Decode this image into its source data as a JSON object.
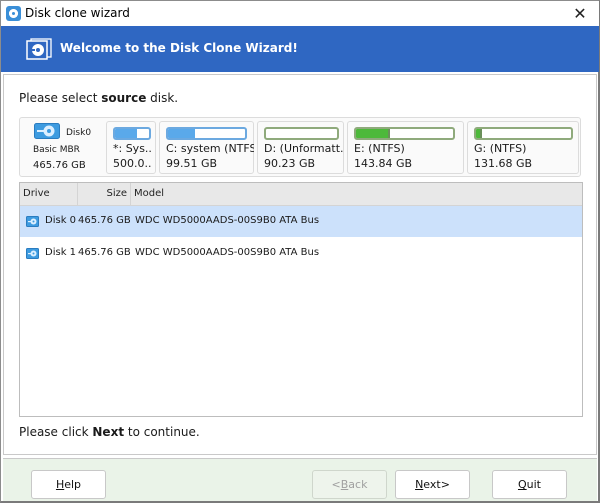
{
  "window": {
    "title": "Disk clone wizard",
    "close_glyph": "✕"
  },
  "banner": {
    "title": "Welcome to the Disk Clone Wizard!"
  },
  "prompt": {
    "prefix": "Please select ",
    "bold": "source",
    "suffix": " disk."
  },
  "disk_map": {
    "name": "Disk0",
    "type": "Basic MBR",
    "size": "465.76 GB",
    "partitions": [
      {
        "label": "*: Sys..",
        "size": "500.0..",
        "used_fraction": 0.65,
        "color": "blue"
      },
      {
        "label": "C: system (NTFS",
        "size": "99.51 GB",
        "used_fraction": 0.35,
        "color": "blue"
      },
      {
        "label": "D: (Unformatt..",
        "size": "90.23 GB",
        "used_fraction": 0.0,
        "color": "green"
      },
      {
        "label": "E: (NTFS)",
        "size": "143.84 GB",
        "used_fraction": 0.35,
        "color": "green"
      },
      {
        "label": "G: (NTFS)",
        "size": "131.68 GB",
        "used_fraction": 0.06,
        "color": "green"
      }
    ]
  },
  "table": {
    "columns": [
      "Drive",
      "Size",
      "Model"
    ],
    "rows": [
      {
        "drive": "Disk 0",
        "size": "465.76 GB",
        "model": "WDC WD5000AADS-00S9B0 ATA Bus",
        "selected": true
      },
      {
        "drive": "Disk 1",
        "size": "465.76 GB",
        "model": "WDC WD5000AADS-00S9B0 ATA Bus",
        "selected": false
      }
    ]
  },
  "hint": {
    "prefix": "Please click ",
    "bold": "Next",
    "suffix": " to continue."
  },
  "buttons": {
    "help": {
      "pre": "",
      "accel": "H",
      "post": "elp"
    },
    "back": {
      "pre": "<",
      "accel": "B",
      "post": "ack",
      "disabled": true
    },
    "next": {
      "pre": "",
      "accel": "N",
      "post": "ext>"
    },
    "quit": {
      "pre": "",
      "accel": "Q",
      "post": "uit"
    }
  },
  "colors": {
    "banner": "#2f67c2",
    "selected_row": "#cce1fb",
    "footer": "#eaf3e8",
    "bar_blue": "#5aa9ea",
    "bar_green": "#4db93a"
  }
}
